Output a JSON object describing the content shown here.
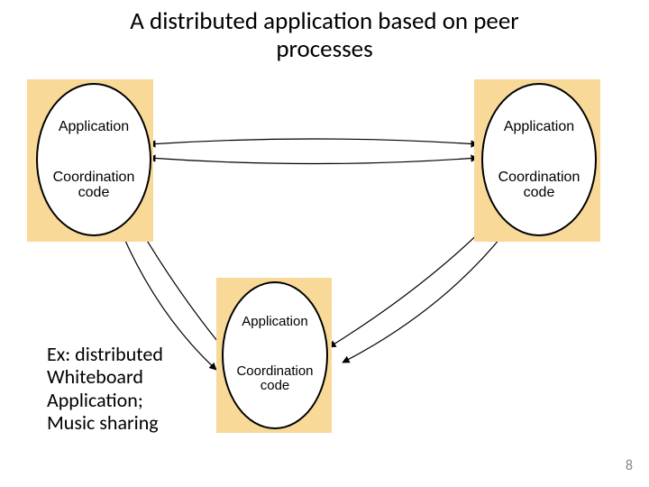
{
  "title_line1": "A distributed application based on peer",
  "title_line2": "processes",
  "peer": {
    "app_label": "Application",
    "coord_label_l1": "Coordination",
    "coord_label_l2": "code"
  },
  "example": {
    "l1": "Ex: distributed",
    "l2": "Whiteboard",
    "l3": "Application;",
    "l4": "Music sharing"
  },
  "page_number": "8"
}
